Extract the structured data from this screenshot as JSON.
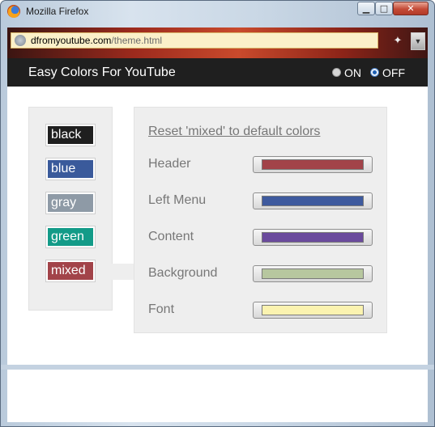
{
  "window": {
    "title": "Mozilla Firefox"
  },
  "address_bar": {
    "domain": "dfromyoutube.com",
    "path": "/theme.html"
  },
  "app": {
    "title": "Easy Colors For YouTube"
  },
  "toggle": {
    "on_label": "ON",
    "off_label": "OFF",
    "selected": "OFF"
  },
  "themes": [
    {
      "label": "black",
      "color": "#1f1f1f"
    },
    {
      "label": "blue",
      "color": "#3a5a9b"
    },
    {
      "label": "gray",
      "color": "#8e9aa6"
    },
    {
      "label": "green",
      "color": "#139b88"
    },
    {
      "label": "mixed",
      "color": "#a24349"
    }
  ],
  "selected_theme": "mixed",
  "reset_link": "Reset 'mixed' to default colors",
  "color_rows": [
    {
      "label": "Header",
      "color": "#a24349"
    },
    {
      "label": "Left Menu",
      "color": "#3e5a9e"
    },
    {
      "label": "Content",
      "color": "#6a4a9c"
    },
    {
      "label": "Background",
      "color": "#b7c79f"
    },
    {
      "label": "Font",
      "color": "#fbf3b0"
    }
  ],
  "icons": [
    "firefox-icon",
    "minimize-icon",
    "maximize-icon",
    "close-icon",
    "site-identity-icon",
    "tools-icon",
    "dropdown-arrow-icon"
  ]
}
